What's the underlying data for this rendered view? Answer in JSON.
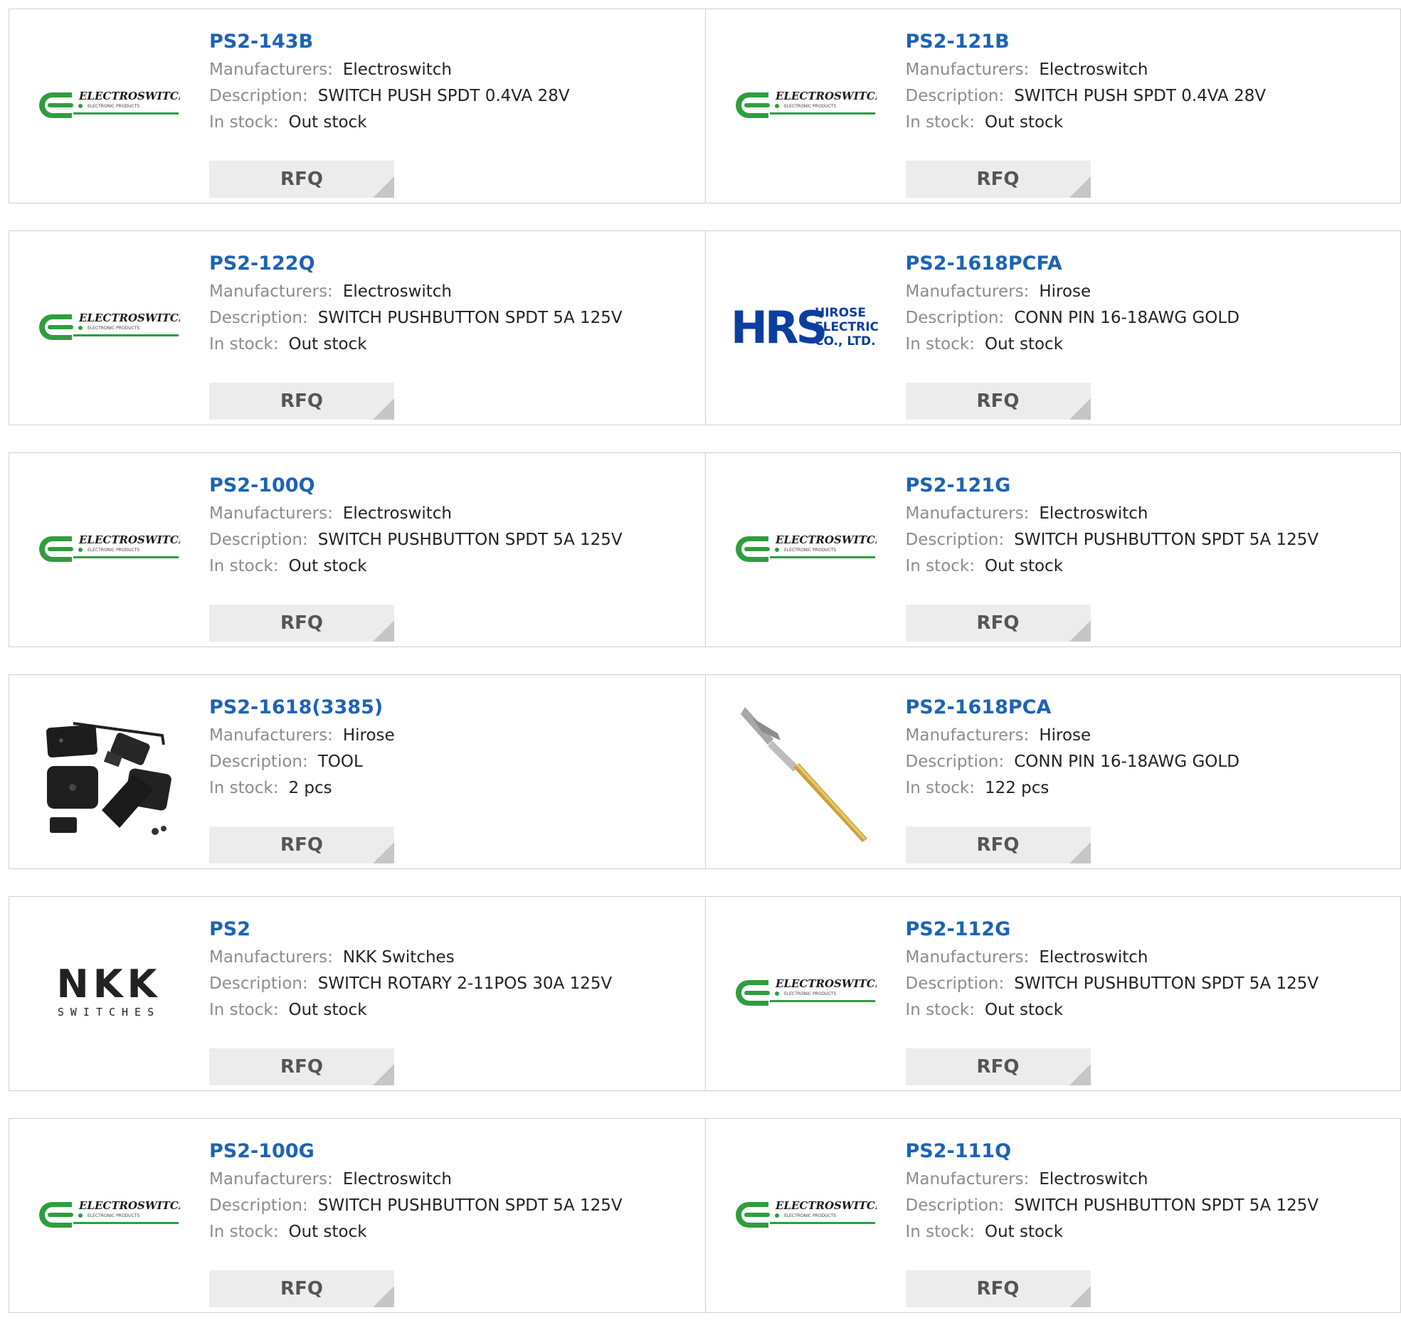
{
  "labels": {
    "manufacturer": "Manufacturers:",
    "description": "Description:",
    "stock": "In stock:",
    "rfq": "RFQ"
  },
  "logo_text": {
    "electroswitch": "ELECTROSWITCH",
    "electroswitch_sub": "ELECTRONIC PRODUCTS",
    "hrs": "HRS",
    "hirose_lines": [
      "HIROSE",
      "ELECTRIC",
      "CO., LTD."
    ],
    "nkk": "NKK",
    "nkk_sub": "SWITCHES"
  },
  "colors": {
    "link": "#1c63b4",
    "electroswitch_green": "#2e9e3e",
    "hirose_blue": "#0b3ea0"
  },
  "products": [
    {
      "part": "PS2-143B",
      "manufacturer": "Electroswitch",
      "description": "SWITCH PUSH SPDT 0.4VA 28V",
      "stock": "Out stock",
      "logo": "electroswitch"
    },
    {
      "part": "PS2-121B",
      "manufacturer": "Electroswitch",
      "description": "SWITCH PUSH SPDT 0.4VA 28V",
      "stock": "Out stock",
      "logo": "electroswitch"
    },
    {
      "part": "PS2-122Q",
      "manufacturer": "Electroswitch",
      "description": "SWITCH PUSHBUTTON SPDT 5A 125V",
      "stock": "Out stock",
      "logo": "electroswitch"
    },
    {
      "part": "PS2-1618PCFA",
      "manufacturer": "Hirose",
      "description": "CONN PIN 16-18AWG GOLD",
      "stock": "Out stock",
      "logo": "hrs"
    },
    {
      "part": "PS2-100Q",
      "manufacturer": "Electroswitch",
      "description": "SWITCH PUSHBUTTON SPDT 5A 125V",
      "stock": "Out stock",
      "logo": "electroswitch"
    },
    {
      "part": "PS2-121G",
      "manufacturer": "Electroswitch",
      "description": "SWITCH PUSHBUTTON SPDT 5A 125V",
      "stock": "Out stock",
      "logo": "electroswitch"
    },
    {
      "part": "PS2-1618(3385)",
      "manufacturer": "Hirose",
      "description": "TOOL",
      "stock": "2 pcs",
      "logo": "tool"
    },
    {
      "part": "PS2-1618PCA",
      "manufacturer": "Hirose",
      "description": "CONN PIN 16-18AWG GOLD",
      "stock": "122 pcs",
      "logo": "pin"
    },
    {
      "part": "PS2",
      "manufacturer": "NKK Switches",
      "description": "SWITCH ROTARY 2-11POS 30A 125V",
      "stock": "Out stock",
      "logo": "nkk"
    },
    {
      "part": "PS2-112G",
      "manufacturer": "Electroswitch",
      "description": "SWITCH PUSHBUTTON SPDT 5A 125V",
      "stock": "Out stock",
      "logo": "electroswitch"
    },
    {
      "part": "PS2-100G",
      "manufacturer": "Electroswitch",
      "description": "SWITCH PUSHBUTTON SPDT 5A 125V",
      "stock": "Out stock",
      "logo": "electroswitch"
    },
    {
      "part": "PS2-111Q",
      "manufacturer": "Electroswitch",
      "description": "SWITCH PUSHBUTTON SPDT 5A 125V",
      "stock": "Out stock",
      "logo": "electroswitch"
    }
  ]
}
